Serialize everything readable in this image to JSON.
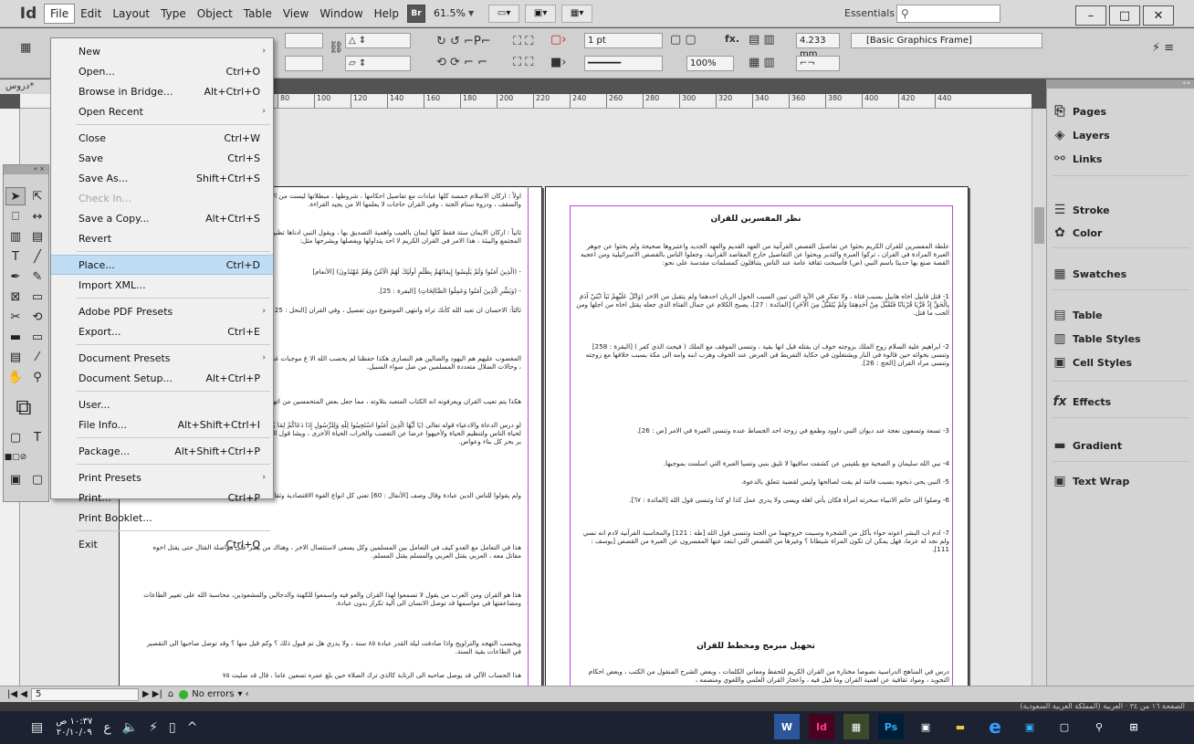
{
  "menubar": {
    "logo": "Id",
    "items": [
      "File",
      "Edit",
      "Layout",
      "Type",
      "Object",
      "Table",
      "View",
      "Window",
      "Help"
    ],
    "bridge_button": "Br",
    "zoom": "61.5%",
    "workspace": "Essentials",
    "window_controls": [
      "–",
      "□",
      "✕"
    ]
  },
  "control": {
    "stroke_weight": "1 pt",
    "width_value": "4.233 mm",
    "zoom_percent": "100%",
    "frame_style": "[Basic Graphics Frame]",
    "fx_label": "fx."
  },
  "document": {
    "tab_label": "دروس*",
    "ruler_ticks": [
      "80",
      "100",
      "120",
      "140",
      "160",
      "180",
      "200",
      "220",
      "240",
      "260",
      "280",
      "300",
      "320",
      "340",
      "360",
      "380",
      "400",
      "420",
      "440"
    ],
    "right_heading_1": "نظر المفسرين للقران",
    "right_heading_2": "تحهيل مبرمج ومخطط للقران",
    "right_paragraphs": [
      "علطة المفسرين للقران الكريم بحثوا عن تفاصيل القصص القرآنية من العهد القديم والعهد الجديد واعتبروها صحيحة ولم يحثوا عن جوهر العبرة المرادة في القران ، تركوا العبرة والتدبر وبحثوا عن التفاصيل خارج المقاصد القرآنية، وجعلوا الناس بالقصص الاسرائيلية ومن اعجبه القصة صنع بها حديثا باسم النبي (ص) فأسبحت ثقافة عامة عند الناس يتناقلون كمسلمات مقدسة على نحو:",
      "1- قتل قابيل اخاه هابيل بسبب فتاة ، ولا تفكر في الآية التي تبين السبب الحول الربان احدهما ولم يتقبل من الاخر (وَاتْلُ عَلَيْهِمْ نَبَأَ ابْنَيْ آدَمَ بِالْحَقِّ إِذْ قَرَّبَا قُرْبَانًا فَتُقُبِّلَ مِنْ أَحَدِهِمَا وَلَمْ يُتَقَبَّلْ مِنَ الْآخَرِ) [المائدة : 27]، يصبح الكلام عن جمال الفتاة الذي جعله يقتل اخاه من اجلها ومن الحب ما قتل.",
      "2- ابراهيم عليه السلام زوج الملك بزوجته خوف ان يقتله قبل انها بقية ، وتنسى الموقف مع الملك ( فيحث الذي كفر ) [البقرة : 258] وتنسى بخوائه حين قالوه في النار ويشتغلون في حكاية التفريط في العرض عند الخوف وهرب ابنه وامه الى مكة بسبب خلافها مع زوجته وتنسى مراد القران [الحج : 26].",
      "3- تسعة وتسعون نعجة عند ديوان النبي داوود وطمع في زوجة احد الجساط عنده وتنسى العبرة في الامر [ص : 26].",
      "4- نبي الله سليمان و الصحية مع بلقيس عن كشفت ساقيها لا تليق بنبي وتسيا العبرة التي اسلمت بموجبها.",
      "5- النبي يحي ذبحوه بسبب فاتنة لم يقت لصالحها وليس لقضية تتعلق بالدعوة.",
      "6- وصلوا الى خاتم الانبياء سحرته امرأة فكان يأتي اهله ويسى ولا يدري عمل كذا او كذا وتنسى قول الله [المائدة : ٦٧].",
      "7- ادم اب البشر اعوته حواء بأكل من الشجرة وسببت خروجهما من الجنة وتنسى قول الله [طه : 121] والمحاسبة القرآنية لادم انه نسي ولم نجد له عزما، فهل يمكن ان تكون المراة شيطانا ؟ وغيرها من القصص التي ابتعد عنها المفسرون عن العبرة من القصص [يوسف : 111].",
      "درس في المناهج الدراسية نصوصا مختارة من القران الكريم للحفظ ومعاني الكلمات ، وبعض الشرح المنقول من الكتب ، وبعض احكام التجويد ، ومواد ثقافية عن اهمية القران وما قيل فيه ، واعجاز القران العلمي واللغوي ومنضمه ،"
    ],
    "left_paragraphs": [
      "اولاً : اركان الاسلام خمسة كلها عبادات مع تفاصيل احكامها ، شروطها ، مبطلاتها ليست من الاسلام ، ولا علاقة لها بالأركان والعرف والقواطع والسقف ، ودروة سنام الجنة ، وفي القران حاجات لا يعلمها الا من يجيد القراءة.",
      "ثانياً : اركان الايمان ستة فقط كلها ايمان بالغيب واهمية التصديق بها ، ويقول النبي ادناها تطبيق الشوائع من القمامات للمحافظة على صحة المجتمع والبيئة ، هذا الامر في القران الكريم لا احد يتداولها ويفصلها ويشرحها مثل:",
      "- (الَّذِينَ آمَنُوا وَلَمْ يَلْبِسُوا إِيمَانَهُمْ بِظُلْمٍ أُولَئِكَ لَهُمُ الْأَمْنُ وَهُمْ مُهْتَدُونَ) [الأنعام]",
      "- (وَبَشِّرِ الَّذِينَ آمَنُوا وَعَمِلُوا الصَّالِحَاتِ) [البقرة : 25].",
      "ثالثاً: الاحسان ان تعبد الله كأنك تراه وانتهى الموضوع دون تفصيل ، وفي القران [النحل : 125] ، [البقرة] ، [هود : 114].",
      "المغضوب عليهم هم اليهود والضالين هم النصارى هكذا حفظنا لم يحصب الله الا غ موجبات غضب الله بما فيها قتل المؤمن اخاه المؤمن متعمدا ، وحالات الضلال متعددة المسلمين من ضل سواء السبيل.",
      "هكذا يتم تعيب القران ويعرفونه انه الكتاب المتعبد بتلاوته ، مما جعل بعض المتحمسين من اتهام المسلمين بالجمود عن فهمه.",
      "لو درس الدعاة والادعياء قوله تعالى (يَا أَيُّهَا الَّذِينَ آمَنُوا اسْتَجِيبُوا لِلَّهِ وَلِلرَّسُولِ إِذَا دَعَاكُمْ لِمَا يُحْيِيكُمْ) وتعمقوا في معانيه بعضهم لعرفوا ان الدين لحياة الناس ولتنظيم الحياة ولأحيهوا عرضا عن التعصب والخراب الحياة الأخرى ، ويشا قول الله داوود اشتغل في الحديد والصلب ، سليمان جو بر بحر كل بناء وعواص.",
      "ولم يقولوا للناس الدين عبادة وقال وصف [الأنفال : 60] تعني كل انواع القوة الاقتصادية وثقافية وسياسية وعسكرية.",
      "هذا في التعامل مع العدو كيف في التعامل بين المسلمين وكل يسعى لاستئصال الاخر ، وهناك من يصر على مواصلة القتال حتى يقتل اخوه مقاتل معه ، العربي يقتل العربي والمسلم يقتل المسلم.",
      "هذا هو القران ومن العرب من يقول لا تسمعوا لهذا القران والعو فيه واسمعوا للكهنة والدجالين والمشعوذين، محاسبة الله على تغيير الطاعات ومضاعفتها في مواسمها قد توصل الانسان الى آلية تكرار بدون عبادة.",
      "ويحسب التهجد والتراويح واذا صادفت ليلة القدر عبادة ٨٥ سنة ، ولا يدري هل تم قبول ذلك ؟ وكم قبل منها ؟ وقد توصل صاحبها الى التقصير في الطاعات بقية السنة.",
      "هذا الحساب الآلي قد يوصل صاحبه الى الرتابة كالذي ترك الصلاة حين بلغ عمره تسعين عاما ، قال قد صليت ٧٥"
    ]
  },
  "file_menu": {
    "items": [
      {
        "label": "New",
        "shortcut": "",
        "submenu": true
      },
      {
        "label": "Open...",
        "shortcut": "Ctrl+O"
      },
      {
        "label": "Browse in Bridge...",
        "shortcut": "Alt+Ctrl+O"
      },
      {
        "label": "Open Recent",
        "shortcut": "",
        "submenu": true
      },
      {
        "label": "Close",
        "shortcut": "Ctrl+W"
      },
      {
        "label": "Save",
        "shortcut": "Ctrl+S"
      },
      {
        "label": "Save As...",
        "shortcut": "Shift+Ctrl+S"
      },
      {
        "label": "Check In...",
        "shortcut": "",
        "disabled": true
      },
      {
        "label": "Save a Copy...",
        "shortcut": "Alt+Ctrl+S"
      },
      {
        "label": "Revert",
        "shortcut": ""
      },
      {
        "label": "Place...",
        "shortcut": "Ctrl+D",
        "hover": true
      },
      {
        "label": "Import XML...",
        "shortcut": ""
      },
      {
        "label": "Adobe PDF Presets",
        "shortcut": "",
        "submenu": true
      },
      {
        "label": "Export...",
        "shortcut": "Ctrl+E"
      },
      {
        "label": "Document Presets",
        "shortcut": "",
        "submenu": true
      },
      {
        "label": "Document Setup...",
        "shortcut": "Alt+Ctrl+P"
      },
      {
        "label": "User...",
        "shortcut": ""
      },
      {
        "label": "File Info...",
        "shortcut": "Alt+Shift+Ctrl+I"
      },
      {
        "label": "Package...",
        "shortcut": "Alt+Shift+Ctrl+P"
      },
      {
        "label": "Print Presets",
        "shortcut": "",
        "submenu": true
      },
      {
        "label": "Print...",
        "shortcut": "Ctrl+P"
      },
      {
        "label": "Print Booklet...",
        "shortcut": ""
      },
      {
        "label": "Exit",
        "shortcut": "Ctrl+Q"
      }
    ]
  },
  "panels": {
    "items": [
      "Pages",
      "Layers",
      "Links",
      "Stroke",
      "Color",
      "Swatches",
      "Table",
      "Table Styles",
      "Cell Styles",
      "Effects",
      "Gradient",
      "Text Wrap"
    ],
    "icons": [
      "pages-icon",
      "layers-icon",
      "links-icon",
      "stroke-icon",
      "color-icon",
      "swatches-icon",
      "table-icon",
      "table-styles-icon",
      "cell-styles-icon",
      "effects-icon",
      "gradient-icon",
      "text-wrap-icon"
    ]
  },
  "status": {
    "page_number": "5",
    "preflight": "No errors"
  },
  "bottom_strip": "الصفحة ١٦ من ٣٤ · العربية (المملكة العربية السعودية)",
  "taskbar": {
    "time": "١٠:٣٧ ص",
    "date": "٢٠/١٠/٠٩",
    "apps": [
      "W",
      "Id",
      "",
      "Ps",
      "",
      "",
      "e",
      "",
      "",
      ""
    ]
  }
}
